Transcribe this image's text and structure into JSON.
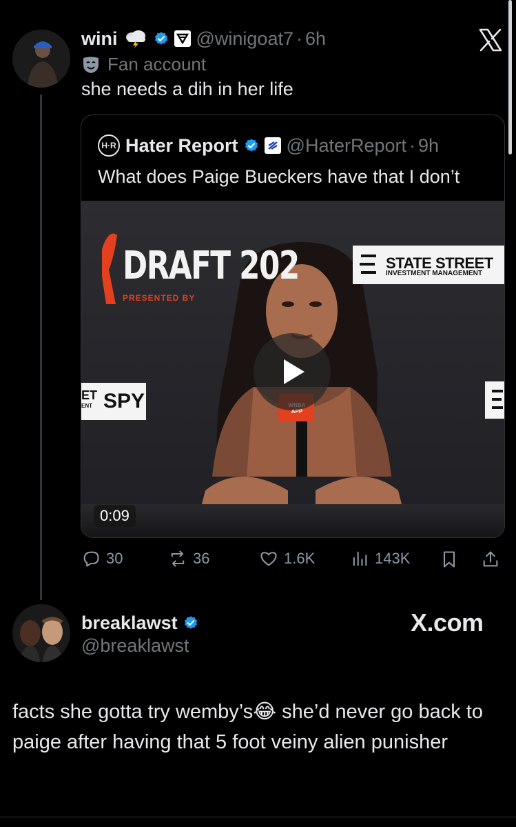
{
  "brand": {
    "x_logo": "X",
    "x_com": "X.com"
  },
  "tweet": {
    "name": "wini",
    "handle": "@winigoat7",
    "dot": "·",
    "time": "6h",
    "label": "Fan account",
    "text": "she needs a dih in her life",
    "quote": {
      "avatar_text": "H·R",
      "name": "Hater Report",
      "handle": "@HaterReport",
      "dot": "·",
      "time": "9h",
      "text": "What does Paige Bueckers have that I don’t",
      "video": {
        "duration": "0:09",
        "banner_left": "DRAFT 202",
        "presented_by": "PRESENTED BY",
        "sponsor_title": "STATE STREET",
        "sponsor_sub": "INVESTMENT MANAGEMENT",
        "left_board_small_top": "ET",
        "left_board_small_bottom": "ENT",
        "left_board_text": "SPY",
        "mic_label": "WNBA APP"
      }
    },
    "stats": {
      "replies": "30",
      "reposts": "36",
      "likes": "1.6K",
      "views": "143K"
    }
  },
  "reply": {
    "name": "breaklawst",
    "handle": "@breaklawst",
    "text": "facts she gotta try wemby’s😂 she’d never go back to paige after having that 5 foot veiny alien punisher"
  },
  "colors": {
    "background": "#000000",
    "verified": "#1d9bf0",
    "muted": "#71767b"
  }
}
